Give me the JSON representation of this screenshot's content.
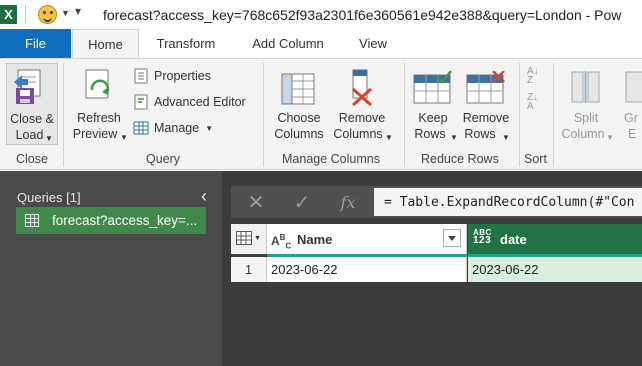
{
  "window": {
    "app_glyph": "X",
    "title": "forecast?access_key=768c652f93a2301f6e360561e942e388&query=London - Pow"
  },
  "tabs": [
    {
      "label": "File"
    },
    {
      "label": "Home"
    },
    {
      "label": "Transform"
    },
    {
      "label": "Add Column"
    },
    {
      "label": "View"
    }
  ],
  "ribbon": {
    "close": {
      "button_line1": "Close &",
      "button_line2": "Load",
      "group": "Close"
    },
    "query": {
      "refresh_line1": "Refresh",
      "refresh_line2": "Preview",
      "properties": "Properties",
      "advanced_editor": "Advanced Editor",
      "manage": "Manage",
      "group": "Query"
    },
    "manage_columns": {
      "choose_line1": "Choose",
      "choose_line2": "Columns",
      "remove_line1": "Remove",
      "remove_line2": "Columns",
      "group": "Manage Columns"
    },
    "reduce_rows": {
      "keep_line1": "Keep",
      "keep_line2": "Rows",
      "remove_line1": "Remove",
      "remove_line2": "Rows",
      "group": "Reduce Rows"
    },
    "sort": {
      "group": "Sort"
    },
    "split": {
      "line1": "Split",
      "line2": "Column"
    },
    "partial_next": {
      "line1": "Gr",
      "line2": "E"
    }
  },
  "queries": {
    "label": "Queries [1]",
    "items": [
      {
        "name": "forecast?access_key=..."
      }
    ]
  },
  "formula": {
    "fx": "fx",
    "text": "= Table.ExpandRecordColumn(#\"Con"
  },
  "grid": {
    "columns": [
      {
        "name": "Name",
        "type_badge_top": "A",
        "type_badge_sub": "B",
        "type_badge_sub2": "C"
      },
      {
        "name": "date",
        "type_badge_top": "ABC",
        "type_badge_bottom": "123"
      }
    ],
    "rows": [
      {
        "index": "1",
        "name": "2023-06-22",
        "date": "2023-06-22"
      }
    ]
  },
  "colors": {
    "file_tab": "#106ebe",
    "query_selected": "#3f8a4b",
    "date_header": "#217346",
    "date_cell": "#d8eede",
    "quality_bar": "#1fa38a"
  }
}
